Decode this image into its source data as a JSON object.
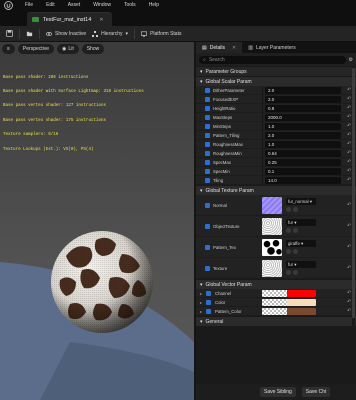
{
  "menu": {
    "items": [
      "File",
      "Edit",
      "Asset",
      "Window",
      "Tools",
      "Help"
    ]
  },
  "document_tab": {
    "title": "TestFur_mat_inst14"
  },
  "toolbar": {
    "show_inactive_label": "Show Inactive",
    "hierarchy_label": "Hierarchy",
    "platform_stats_label": "Platform Stats"
  },
  "viewport": {
    "perspective_label": "Perspective",
    "lit_label": "Lit",
    "show_label": "Show",
    "stats": [
      "Base pass shader: 286 instructions",
      "Base pass shader with Surface Lightmap: 318 instructions",
      "Base pass vertex shader: 127 instructions",
      "Base pass vertex shader: 175 instructions",
      "Texture samplers: 8/16",
      "Texture Lookups (Est.): VS(0), PS(4)"
    ]
  },
  "panel": {
    "tabs": [
      "Details",
      "Layer Parameters"
    ],
    "search_placeholder": "Search",
    "parameter_groups_label": "Parameter Groups",
    "scalar_section_label": "Global Scalar Param",
    "scalar_params": [
      {
        "name": "DitherParameter",
        "value": "2.0"
      },
      {
        "name": "FocusedEXP",
        "value": "2.0"
      },
      {
        "name": "HeightRatio",
        "value": "0.8"
      },
      {
        "name": "MaxSteps",
        "value": "2000.0"
      },
      {
        "name": "MinSteps",
        "value": "1.0"
      },
      {
        "name": "Pattern_Tiling",
        "value": "2.0"
      },
      {
        "name": "RoughnessMax",
        "value": "1.0"
      },
      {
        "name": "RoughnessMin",
        "value": "0.64"
      },
      {
        "name": "SpecMax",
        "value": "0.25"
      },
      {
        "name": "SpecMin",
        "value": "0.1"
      },
      {
        "name": "Tiling",
        "value": "14.0"
      }
    ],
    "texture_section_label": "Global Texture Param",
    "texture_params": [
      {
        "name": "Normal",
        "asset": "fur_normal",
        "thumb": "normal"
      },
      {
        "name": "ObjectTexture",
        "asset": "fur",
        "thumb": "fur"
      },
      {
        "name": "Pattern_Tex",
        "asset": "giraffe",
        "thumb": "giraffe"
      },
      {
        "name": "Texture",
        "asset": "fur",
        "thumb": "fur"
      }
    ],
    "vector_section_label": "Global Vector Param",
    "vector_params": [
      {
        "name": "Channel",
        "color": "#ff0000"
      },
      {
        "name": "Color",
        "color": "#f6dcb8"
      },
      {
        "name": "Pattern_Color",
        "color": "#7a4a30"
      }
    ],
    "general_label": "General",
    "save_sibling_label": "Save Sibling",
    "save_child_label": "Save Chi"
  },
  "colors": {
    "accent_blue": "#2c6fd3",
    "checkbox": "#2c6fd3",
    "stats_yellow": "#e8e24a"
  }
}
